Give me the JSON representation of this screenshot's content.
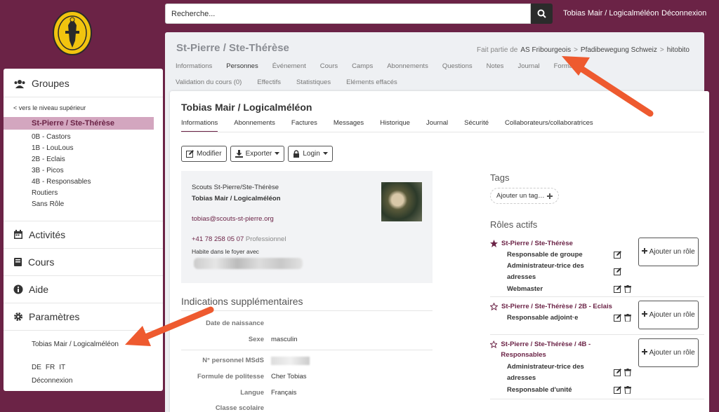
{
  "topbar": {
    "search_placeholder": "Recherche...",
    "user": "Tobias Mair / Logicalméléon",
    "logout": "Déconnexion"
  },
  "sidebar": {
    "groups_label": "Groupes",
    "up_link": "< vers le niveau supérieur",
    "active_group": "St-Pierre / Ste-Thérèse",
    "items": [
      "0B - Castors",
      "1B - LouLous",
      "2B - Eclais",
      "3B - Picos",
      "4B - Responsables",
      "Routiers",
      "Sans Rôle"
    ],
    "activities": "Activités",
    "courses": "Cours",
    "help": "Aide",
    "settings": "Paramètres",
    "user": "Tobias Mair / Logicalméléon",
    "langs": [
      "DE",
      "FR",
      "IT"
    ],
    "logout": "Déconnexion"
  },
  "group": {
    "title": "St-Pierre / Ste-Thérèse",
    "part_of": "Fait partie de",
    "crumbs": [
      "AS Fribourgeois",
      ">",
      "Pfadibewegung Schweiz",
      ">",
      "hitobito"
    ],
    "tabs1": [
      "Informations",
      "Personnes",
      "Événement",
      "Cours",
      "Camps",
      "Abonnements",
      "Questions",
      "Notes",
      "Journal",
      "Formation"
    ],
    "tabs2": [
      "Validation du cours (0)",
      "Effectifs",
      "Statistiques",
      "Eléments effacés"
    ]
  },
  "person": {
    "title": "Tobias Mair / Logicalméléon",
    "tabs": [
      "Informations",
      "Abonnements",
      "Factures",
      "Messages",
      "Historique",
      "Journal",
      "Sécurité",
      "Collaborateurs/collaboratrices"
    ],
    "buttons": {
      "edit": "Modifier",
      "export": "Exporter",
      "login": "Login"
    },
    "info": {
      "org": "Scouts St-Pierre/Ste-Thérèse",
      "name": "Tobias Mair / Logicalméléon",
      "email": "tobias@scouts-st-pierre.org",
      "phone": "+41 78 258 05 07",
      "phone_type": "Professionnel",
      "household": "Habite dans le foyer avec"
    },
    "extra_heading": "Indications supplémentaires",
    "fields": [
      {
        "label": "Date de naissance",
        "value": ""
      },
      {
        "label": "Sexe",
        "value": "masculin"
      },
      {
        "label": "N° personnel MSdS",
        "value": ""
      },
      {
        "label": "Formule de politesse",
        "value": "Cher Tobias"
      },
      {
        "label": "Langue",
        "value": "Français"
      },
      {
        "label": "Classe scolaire",
        "value": ""
      }
    ],
    "tags_heading": "Tags",
    "add_tag": "Ajouter un tag…",
    "roles_heading": "Rôles actifs",
    "role_groups": [
      {
        "group": "St-Pierre / Ste-Thérèse",
        "roles": [
          "Responsable de groupe",
          "Administrateur-trice des adresses",
          "Webmaster"
        ]
      },
      {
        "group": "St-Pierre / Ste-Thérèse / 2B - Eclais",
        "roles": [
          "Responsable adjoint·e"
        ]
      },
      {
        "group": "St-Pierre / Ste-Thérèse / 4B - Responsables",
        "roles": [
          "Administrateur-trice des adresses",
          "Responsable d'unité"
        ]
      }
    ],
    "add_role": "Ajouter un rôle"
  },
  "colors": {
    "brand": "#6b2346",
    "active_bg": "#d3a6bf",
    "arrow": "#ee5a2f"
  }
}
